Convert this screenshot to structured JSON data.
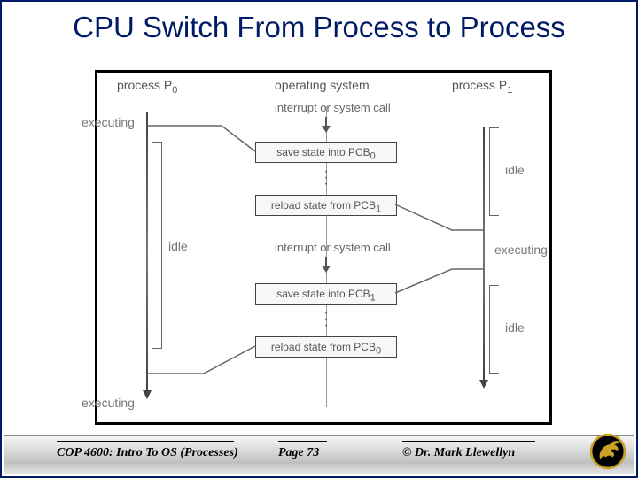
{
  "title": "CPU Switch From Process to Process",
  "columns": {
    "left": "process P",
    "left_sub": "0",
    "mid": "operating system",
    "right": "process P",
    "right_sub": "1"
  },
  "labels": {
    "executing": "executing",
    "idle": "idle",
    "interrupt": "interrupt or system call"
  },
  "os_boxes": {
    "save0": "save state into PCB",
    "save0_sub": "0",
    "reload1": "reload state from PCB",
    "reload1_sub": "1",
    "save1": "save state into PCB",
    "save1_sub": "1",
    "reload0": "reload state from PCB",
    "reload0_sub": "0"
  },
  "footer": {
    "left": "COP 4600: Intro To OS  (Processes)",
    "mid": "Page 73",
    "right": "© Dr. Mark Llewellyn"
  }
}
